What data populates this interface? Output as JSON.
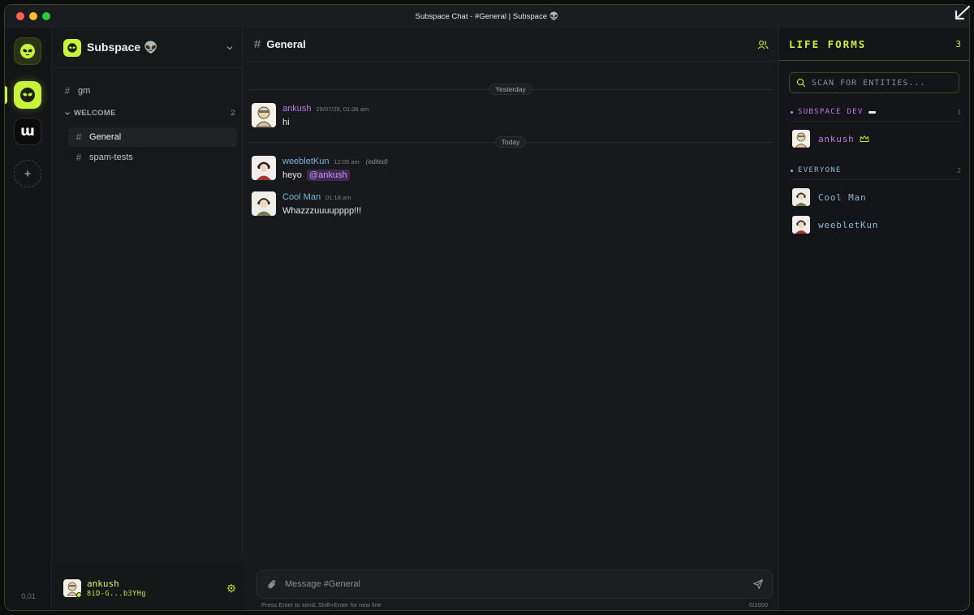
{
  "window": {
    "title": "Subspace Chat - #General | Subspace 👽"
  },
  "rail": {
    "servers": [
      {
        "name": "subspace-alien",
        "icon": "alien-face-icon"
      },
      {
        "name": "active-server",
        "icon": "alien-face-icon"
      },
      {
        "name": "w-server",
        "letter": "ɯ"
      }
    ],
    "add_label": "+",
    "version": "0.01"
  },
  "sidebar": {
    "server_name": "Subspace 👽",
    "pinned_channel": "gm",
    "category": {
      "label": "WELCOME",
      "count": "2"
    },
    "channels": [
      {
        "label": "General",
        "active": true
      },
      {
        "label": "spam-tests",
        "active": false
      }
    ]
  },
  "user": {
    "name": "ankush",
    "id": "8iD-G...b3YHg"
  },
  "chat": {
    "channel_name": "General",
    "dividers": {
      "yesterday": "Yesterday",
      "today": "Today"
    },
    "messages": [
      {
        "author": "ankush",
        "author_color": "#b77fe0",
        "time": "29/07/25, 01:36 am",
        "text": "hi",
        "edited": ""
      },
      {
        "author": "weebletKun",
        "author_color": "#7bb6d6",
        "time": "12:05 am",
        "text": "heyo",
        "mention": "@ankush",
        "edited": "(edited)"
      },
      {
        "author": "Cool Man",
        "author_color": "#7bb6d6",
        "time": "01:18 am",
        "text": "Whazzzuuuupppp!!!",
        "edited": ""
      }
    ],
    "composer_placeholder": "Message #General",
    "hint": "Press Enter to send, Shift+Enter for new line",
    "char_count": "0/2000"
  },
  "life_forms": {
    "title": "LIFE FORMS",
    "count": "3",
    "search_placeholder": "SCAN FOR ENTITIES...",
    "roles": [
      {
        "label": "SUBSPACE DEV",
        "count": "1",
        "color": "#c47be6",
        "members": [
          {
            "name": "ankush",
            "color": "#b77fe0"
          }
        ]
      },
      {
        "label": "EVERYONE",
        "count": "2",
        "color": "#8bb9d3",
        "members": [
          {
            "name": "Cool Man",
            "color": "#8bb9d3"
          },
          {
            "name": "weebletKun",
            "color": "#8bb9d3"
          }
        ]
      }
    ]
  },
  "colors": {
    "accent": "#c9f23a",
    "dev_role": "#c47be6",
    "member_blue": "#7bb6d6"
  }
}
